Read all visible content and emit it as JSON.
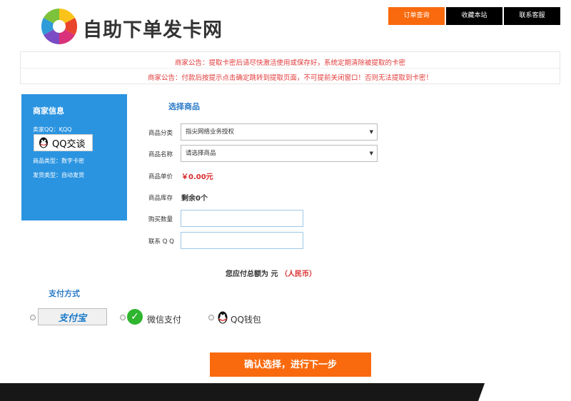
{
  "header": {
    "site_title": "自助下单发卡网",
    "nav": [
      "订单查询",
      "收藏本站",
      "联系客服"
    ],
    "active_nav_index": 0
  },
  "notice": {
    "line1": "商家公告：提取卡密后请尽快激活使用或保存好，系统定期清除被提取的卡密",
    "line2": "商家公告：付款后按提示点击确定跳转到提取页面，不可提前关闭窗口！否则无法提取到卡密！"
  },
  "merchant": {
    "title": "商家信息",
    "seller_qq": "卖家QQ：ⱩQQ",
    "qq_chat_label": "QQ交谈",
    "product_type": "商品类型：数字卡密",
    "delivery_type": "发货类型：自动发货"
  },
  "form": {
    "section_title": "选择商品",
    "category_label": "商品分类",
    "category_value": "指尖网络业务授权",
    "name_label": "商品名称",
    "name_placeholder": "请选择商品",
    "price_label": "商品单价",
    "price_value": "￥0.00元",
    "stock_label": "商品库存",
    "stock_value": "剩余0个",
    "quantity_label": "购买数量",
    "qq_label": "联系 Q Q",
    "total_prefix": "您应付总额为",
    "total_unit": "元",
    "total_currency": "（人民币）"
  },
  "payment": {
    "title": "支付方式",
    "alipay_label": "支付宝",
    "wechat_label": "微信支付",
    "qq_label": "QQ钱包"
  },
  "submit_label": "确认选择，进行下一步",
  "colors": {
    "accent_orange": "#f96a0e",
    "panel_blue": "#2b94e1",
    "notice_red": "#e23b3b"
  }
}
